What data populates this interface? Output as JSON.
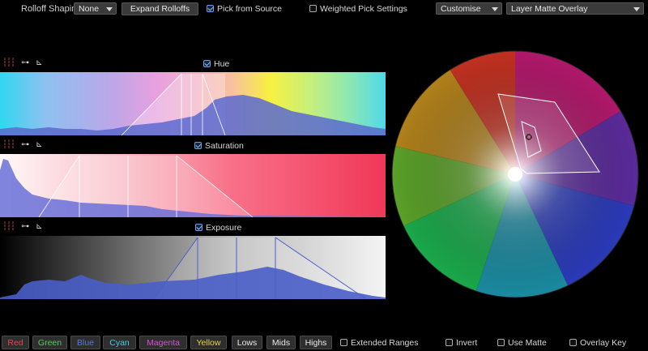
{
  "toolbar": {
    "rolloff_label": "Rolloff Shaping:",
    "rolloff_value": "None",
    "expand_button": "Expand Rolloffs",
    "pick_from_source": "Pick from Source",
    "pick_from_source_checked": true,
    "weighted_pick": "Weighted Pick Settings",
    "weighted_pick_checked": false,
    "preset_value": "Customise",
    "overlay_value": "Layer Matte Overlay"
  },
  "panels": [
    {
      "label": "Hue",
      "checked": true
    },
    {
      "label": "Saturation",
      "checked": true
    },
    {
      "label": "Exposure",
      "checked": true
    }
  ],
  "icons": [
    "sliders-icon",
    "key-icon",
    "curve-axis-icon"
  ],
  "bottom": {
    "buttons": [
      {
        "label": "Red",
        "color": "#e0474f"
      },
      {
        "label": "Green",
        "color": "#4fd05a"
      },
      {
        "label": "Blue",
        "color": "#5a74e6"
      },
      {
        "label": "Cyan",
        "color": "#3fd0e0"
      },
      {
        "label": "Magenta",
        "color": "#d452d4"
      },
      {
        "label": "Yellow",
        "color": "#e6d43a"
      },
      {
        "label": "Lows",
        "color": "#e8e8e8"
      },
      {
        "label": "Mids",
        "color": "#e8e8e8"
      },
      {
        "label": "Highs",
        "color": "#e8e8e8"
      }
    ],
    "extended_ranges": "Extended Ranges",
    "invert": "Invert",
    "use_matte": "Use Matte",
    "overlay_key": "Overlay Key"
  }
}
